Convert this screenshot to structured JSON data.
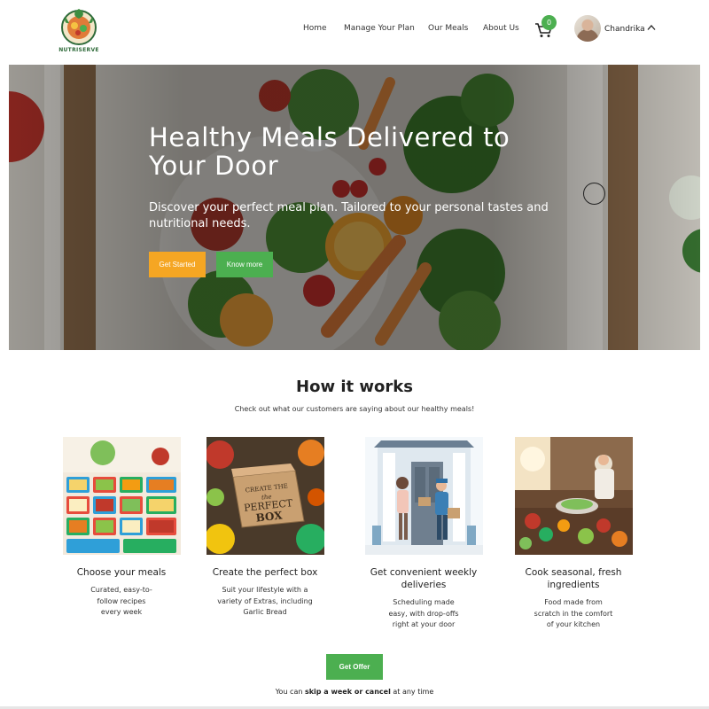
{
  "brand": {
    "name": "NUTRISERVE"
  },
  "nav": {
    "items": [
      "Home",
      "Manage Your Plan",
      "Our Meals",
      "About Us"
    ],
    "cart_count": "0",
    "user_name": "Chandrika"
  },
  "hero": {
    "title": "Healthy Meals Delivered to Your Door",
    "subtitle": "Discover your perfect meal plan. Tailored to your personal tastes and nutritional needs.",
    "primary_button": "Get Started",
    "secondary_button": "Know more"
  },
  "how": {
    "title": "How it works",
    "subtitle": "Check out what our customers are saying about our healthy meals!",
    "steps": [
      {
        "title": "Choose your meals",
        "desc": "Curated, easy-to-follow recipes every week",
        "image": "meal-prep-containers"
      },
      {
        "title": "Create the perfect box",
        "desc": "Suit your lifestyle with a variety of Extras, including Garlic Bread",
        "image": "perfect-box"
      },
      {
        "title": "Get convenient weekly deliveries",
        "desc": "Scheduling made easy, with drop-offs right at your door",
        "image": "door-delivery"
      },
      {
        "title": "Cook seasonal, fresh ingredients",
        "desc": "Food made from scratch in the comfort of your kitchen",
        "image": "kitchen-cooking"
      }
    ]
  },
  "offer": {
    "button": "Get Offer",
    "note_prefix": "You can ",
    "note_bold": "skip a week or cancel",
    "note_suffix": " at any time"
  },
  "colors": {
    "accent_green": "#4caf50",
    "accent_orange": "#f5a623",
    "text_dark": "#222222"
  }
}
